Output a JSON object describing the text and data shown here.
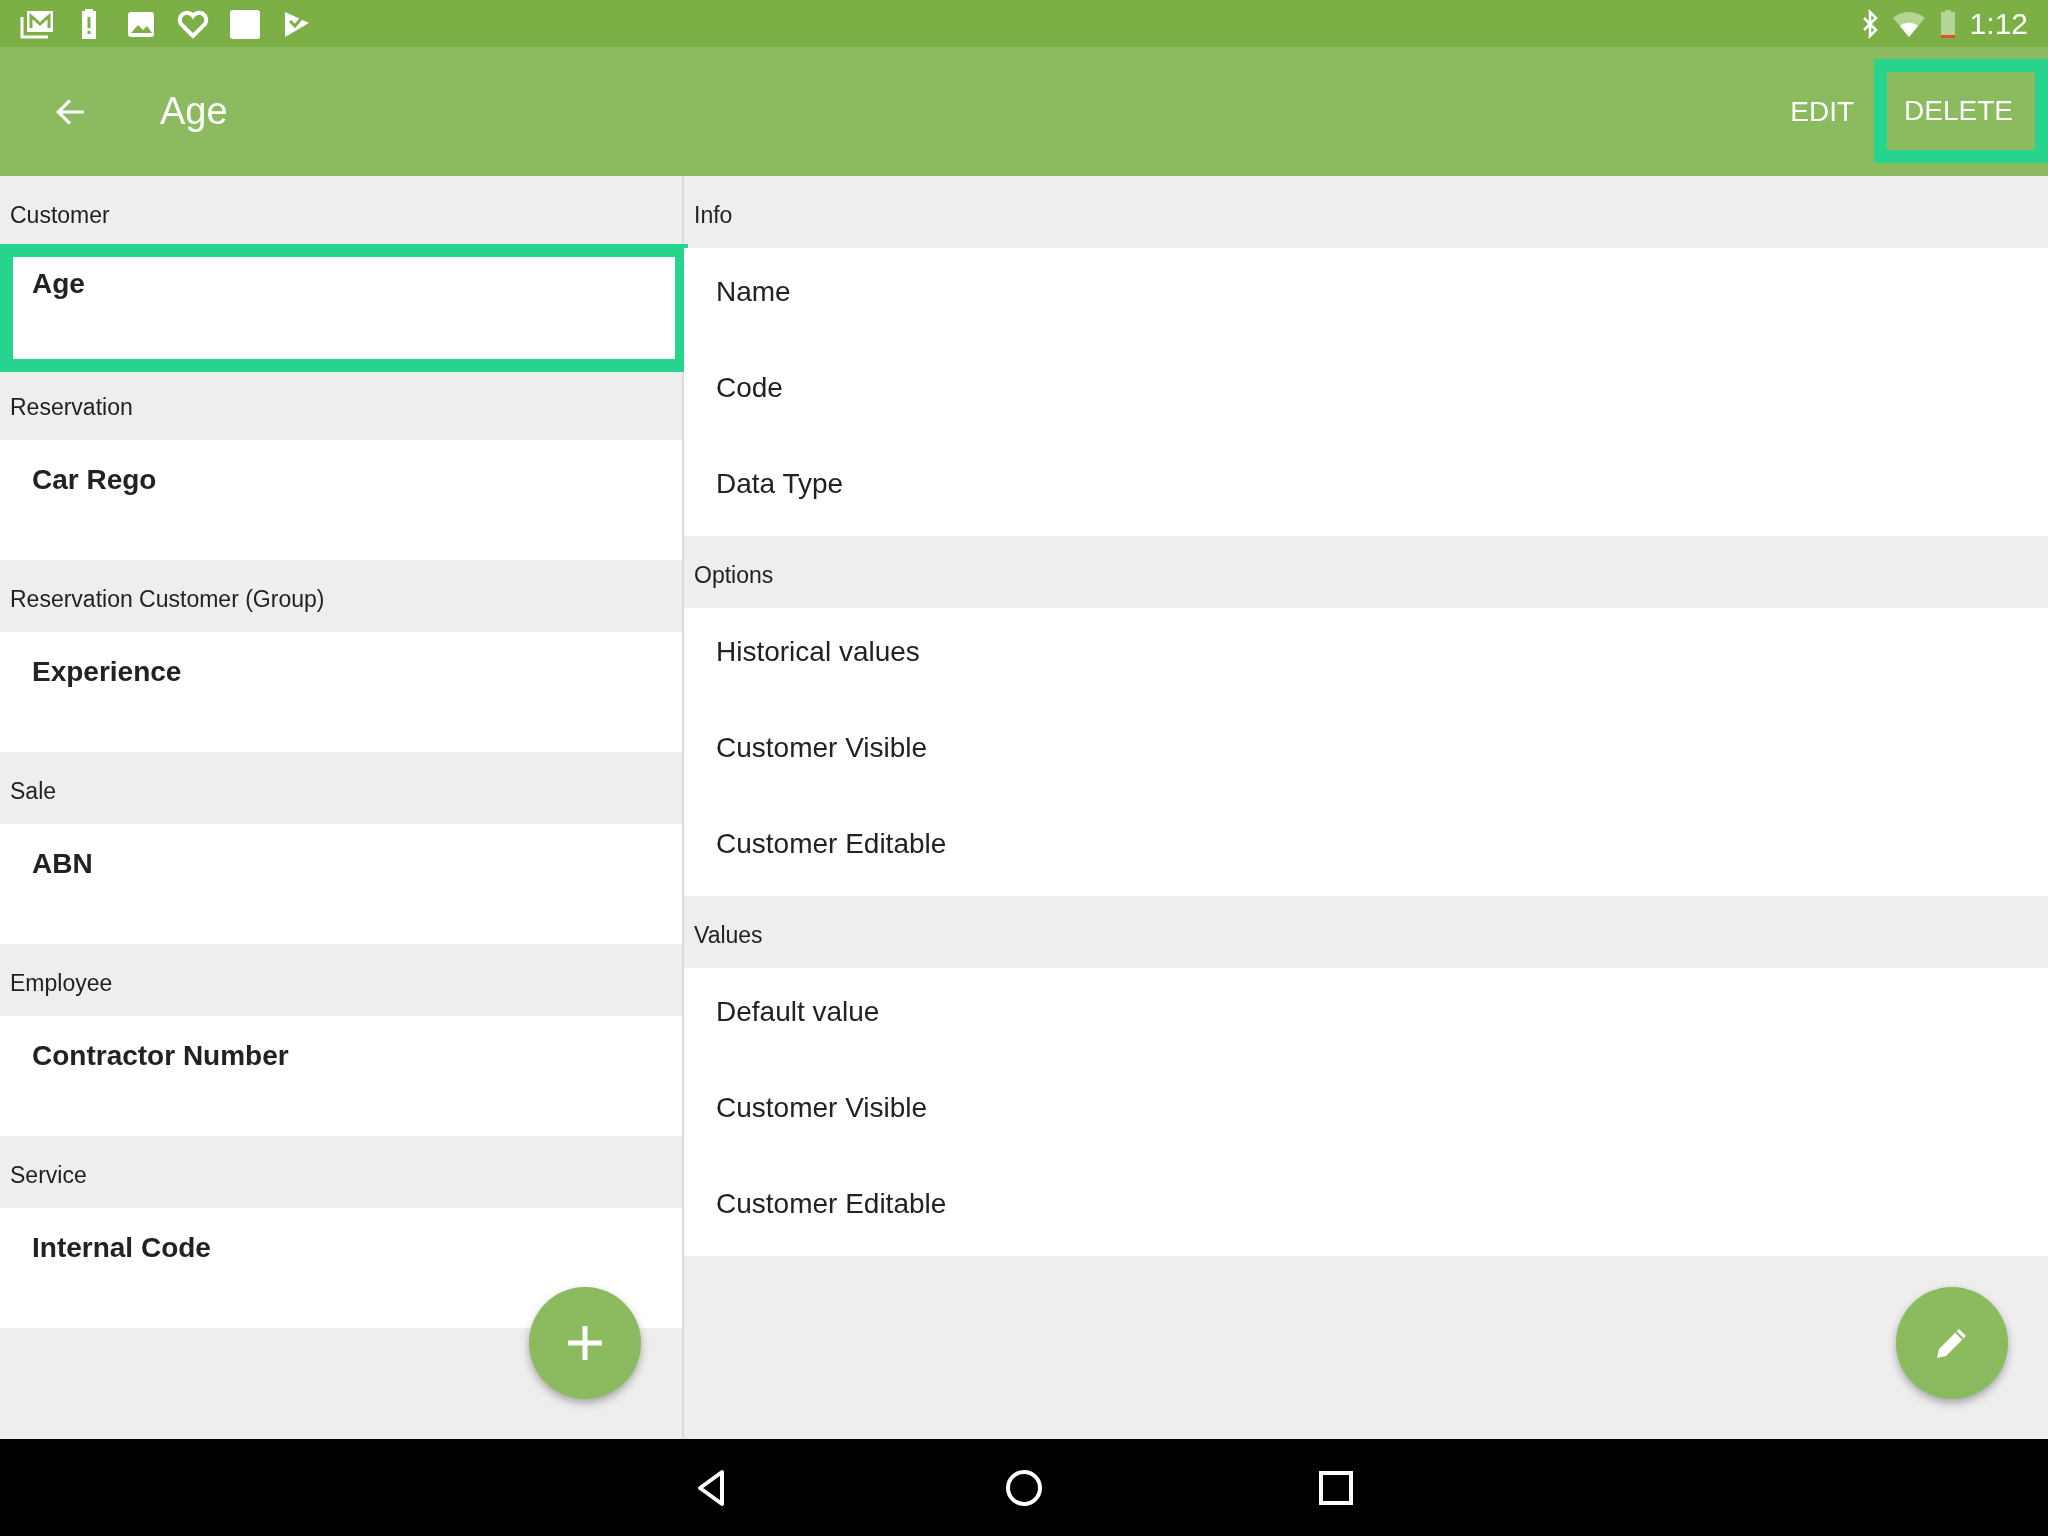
{
  "status_bar": {
    "time": "1:12"
  },
  "app_bar": {
    "title": "Age",
    "actions": [
      {
        "label": "EDIT",
        "highlighted": false
      },
      {
        "label": "DELETE",
        "highlighted": true
      }
    ]
  },
  "attribute_list": {
    "sections": [
      {
        "header": "Customer",
        "items": [
          {
            "label": "Age",
            "selected": true
          }
        ]
      },
      {
        "header": "Reservation",
        "items": [
          {
            "label": "Car Rego",
            "selected": false
          }
        ]
      },
      {
        "header": "Reservation Customer (Group)",
        "items": [
          {
            "label": "Experience",
            "selected": false
          }
        ]
      },
      {
        "header": "Sale",
        "items": [
          {
            "label": "ABN",
            "selected": false
          }
        ]
      },
      {
        "header": "Employee",
        "items": [
          {
            "label": "Contractor Number",
            "selected": false
          }
        ]
      },
      {
        "header": "Service",
        "items": [
          {
            "label": "Internal Code",
            "selected": false
          }
        ]
      }
    ]
  },
  "detail": {
    "sections": [
      {
        "header": "Info",
        "rows": [
          "Name",
          "Code",
          "Data Type"
        ]
      },
      {
        "header": "Options",
        "rows": [
          "Historical values",
          "Customer Visible",
          "Customer Editable"
        ]
      },
      {
        "header": "Values",
        "rows": [
          "Default value",
          "Customer Visible",
          "Customer Editable"
        ]
      }
    ]
  }
}
